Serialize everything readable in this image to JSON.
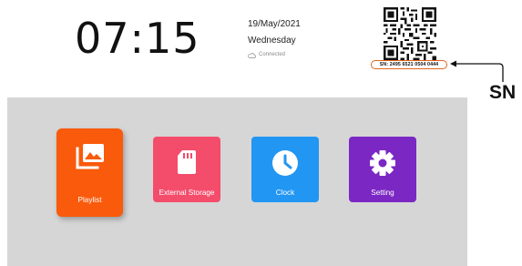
{
  "header": {
    "time": "07:15",
    "date": "19/May/2021",
    "weekday": "Wednesday",
    "connection_status": "Connected",
    "connection_icon": "cloud-icon",
    "qr_icon": "qr-code-icon",
    "sn_text": "SN: 2495 6521 0504 0444"
  },
  "annotation": {
    "label": "SN",
    "arrow_color": "#111111",
    "highlight_color": "#e2661f"
  },
  "apps": [
    {
      "label": "Playlist",
      "icon": "gallery-icon",
      "color": "#f95a0b"
    },
    {
      "label": "External Storage",
      "icon": "sd-card-icon",
      "color": "#f44c6b"
    },
    {
      "label": "Clock",
      "icon": "clock-icon",
      "color": "#2196f3"
    },
    {
      "label": "Setting",
      "icon": "gear-icon",
      "color": "#7b27c4"
    }
  ],
  "panel_color": "#d6d6d6"
}
